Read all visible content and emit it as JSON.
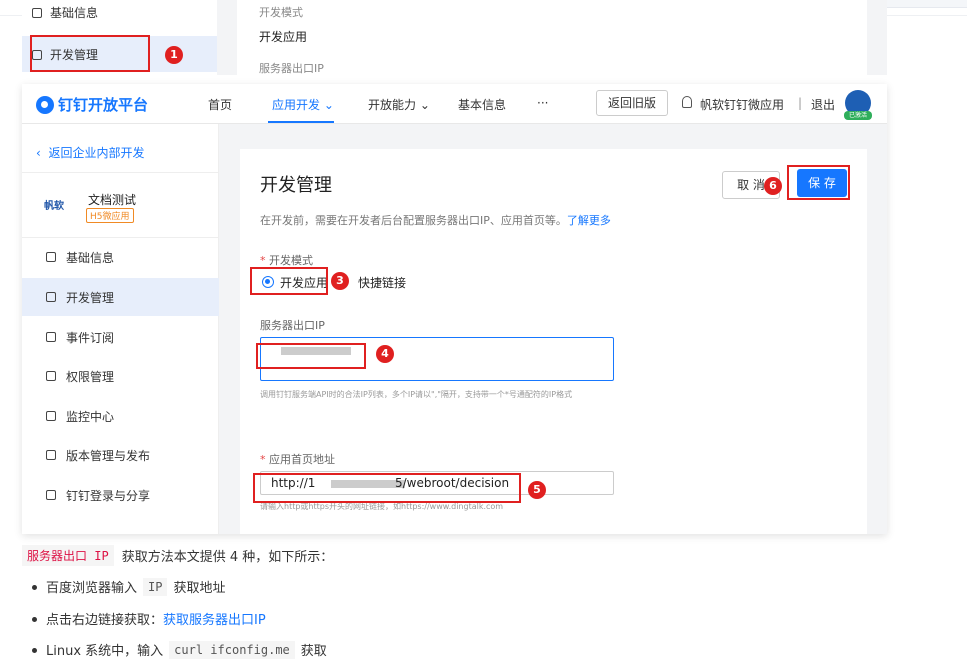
{
  "crop1": {
    "top_item_label": "基础信息",
    "dev_item_label": "开发管理",
    "mode_label": "开发模式",
    "mode_value": "开发应用",
    "ip_label": "服务器出口IP"
  },
  "nav": {
    "logo": "钉钉开放平台",
    "items": [
      "首页",
      "应用开发",
      "开放能力",
      "基本信息",
      "···"
    ],
    "old_version": "返回旧版",
    "app_name": "帆软钉钉微应用",
    "separator": "|",
    "logout": "退出",
    "avatar_badge": "已激活"
  },
  "sidebar": {
    "back": "返回企业内部开发",
    "app_logo": "帆软",
    "app_name": "文档测试",
    "app_tag": "H5微应用",
    "menu": [
      "基础信息",
      "开发管理",
      "事件订阅",
      "权限管理",
      "监控中心",
      "版本管理与发布",
      "钉钉登录与分享"
    ]
  },
  "panel": {
    "title": "开发管理",
    "desc": "在开发前，需要在开发者后台配置服务器出口IP、应用首页等。",
    "learn_more": "了解更多",
    "cancel": "取 消",
    "save": "保 存",
    "dev_mode_label": "开发模式",
    "opt_dev": "开发应用",
    "opt_link": "快捷链接",
    "ip_label": "服务器出口IP",
    "ip_hint": "调用钉钉服务端API时的合法IP列表，多个IP请以\",\"隔开，支持带一个*号通配符的IP格式",
    "home_label": "应用首页地址",
    "url_start": "http://1",
    "url_end": "5/webroot/decision",
    "url_hint": "请输入http或https开头的网址链接，如https://www.dingtalk.com",
    "required_mark": "*"
  },
  "annotations": [
    "1",
    "3",
    "4",
    "5",
    "6"
  ],
  "article": {
    "intro_code": "服务器出口 IP",
    "intro_text": "获取方法本文提供 4 种，如下所示：",
    "b1_pre": "百度浏览器输入",
    "b1_code": "IP",
    "b1_post": "获取地址",
    "b2_pre": "点击右边链接获取：",
    "b2_link": "获取服务器出口IP",
    "b3_pre": "Linux 系统中，输入",
    "b3_code": "curl ifconfig.me",
    "b3_post": "获取"
  }
}
